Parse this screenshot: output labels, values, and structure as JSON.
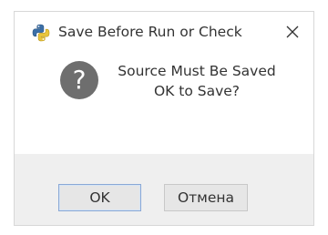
{
  "dialog": {
    "title": "Save Before Run or Check",
    "app_icon": "python-icon",
    "close_icon": "close-icon",
    "message_icon": "question-icon",
    "message_icon_glyph": "?",
    "message_line1": "Source Must Be Saved",
    "message_line2": "OK to Save?",
    "ok_label": "OK",
    "cancel_label": "Отмена"
  }
}
